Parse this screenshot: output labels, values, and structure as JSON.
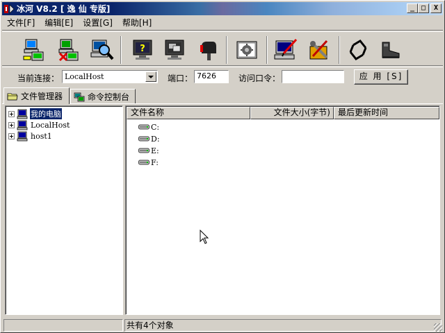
{
  "window": {
    "title": "冰河 V8.2 [ 逸 仙 专版]",
    "controls": {
      "minimize": "_",
      "maximize": "□",
      "close": "X"
    }
  },
  "menu": [
    {
      "label": "文件[F]"
    },
    {
      "label": "编辑[E]"
    },
    {
      "label": "设置[G]"
    },
    {
      "label": "帮助[H]"
    }
  ],
  "toolbar": {
    "icons": [
      "connect-computer-icon",
      "disconnect-computer-icon",
      "search-computer-icon",
      "system-info-icon",
      "screen-capture-icon",
      "mailbox-icon",
      "control-panel-icon",
      "config-server-icon",
      "tools-icon",
      "refresh-icon",
      "exit-boot-icon"
    ]
  },
  "connection": {
    "current_label": "当前连接：",
    "current_value": "LocalHost",
    "port_label": "端口：",
    "port_value": "7626",
    "password_label": "访问口令：",
    "password_value": "",
    "apply_label": "应 用 [S]"
  },
  "tabs": [
    {
      "label": "文件管理器",
      "active": true
    },
    {
      "label": "命令控制台",
      "active": false
    }
  ],
  "tree": {
    "nodes": [
      {
        "label": "我的电脑",
        "selected": true
      },
      {
        "label": "LocalHost",
        "selected": false
      },
      {
        "label": "host1",
        "selected": false
      }
    ]
  },
  "list": {
    "columns": [
      "文件名称",
      "文件大小(字节)",
      "最后更新时间"
    ],
    "rows": [
      "C:",
      "D:",
      "E:",
      "F:"
    ]
  },
  "status": {
    "left": "",
    "right": "共有4个对象"
  },
  "colors": {
    "face": "#d4d0c8",
    "title_active": "#0a246a",
    "selection": "#0a246a"
  }
}
